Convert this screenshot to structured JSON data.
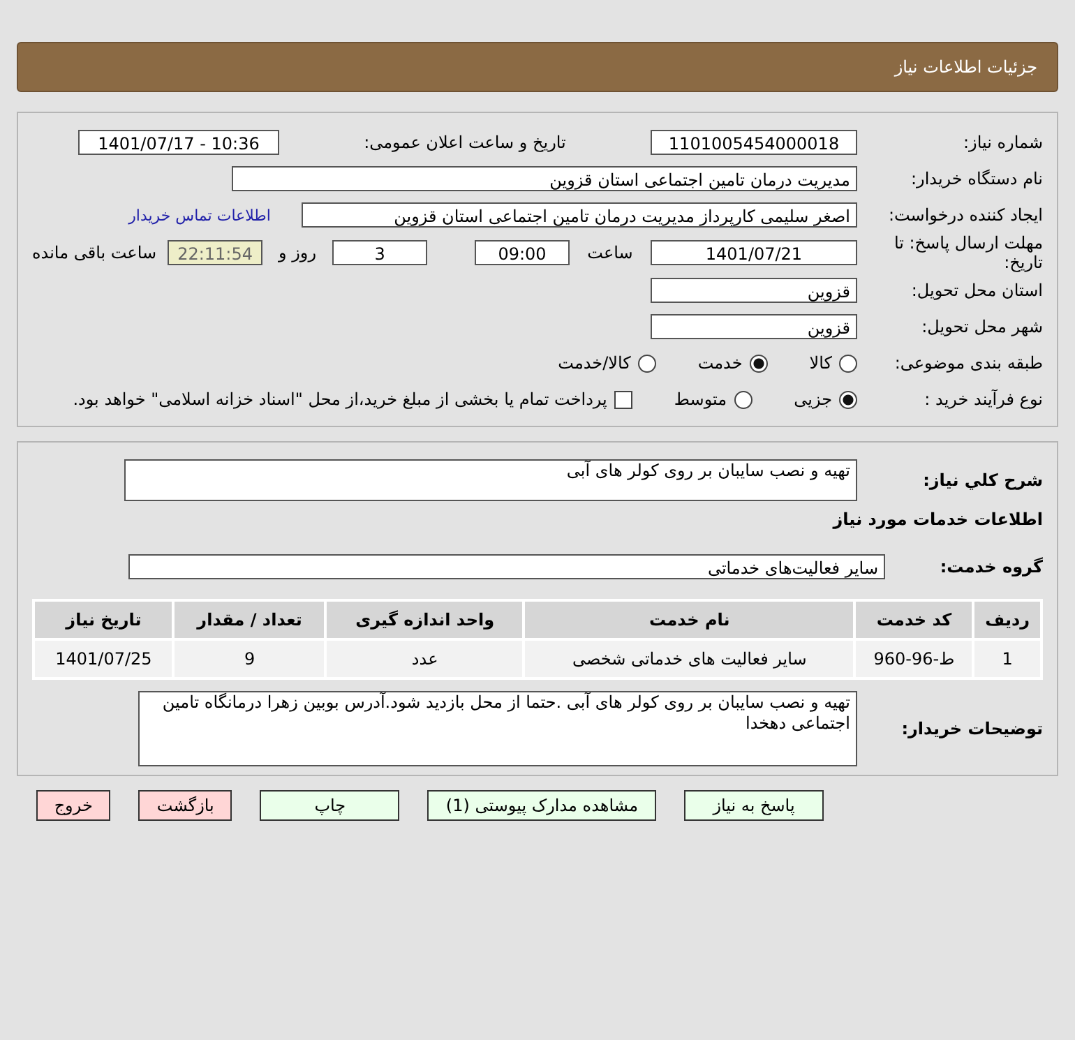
{
  "header": {
    "title": "جزئیات اطلاعات نیاز"
  },
  "details": {
    "need_number": {
      "label": "شماره نیاز:",
      "value": "1101005454000018"
    },
    "announce": {
      "label": "تاریخ و ساعت اعلان عمومی:",
      "value": "1401/07/17 - 10:36"
    },
    "buyer": {
      "label": "نام دستگاه خریدار:",
      "value": "مدیریت درمان تامین اجتماعی استان قزوین"
    },
    "creator": {
      "label": "ایجاد کننده درخواست:",
      "value": "اصغر سلیمی کارپرداز مدیریت درمان تامین اجتماعی استان قزوین",
      "link": "اطلاعات تماس خریدار"
    },
    "deadline": {
      "label": "مهلت ارسال پاسخ: تا تاریخ:",
      "date": "1401/07/21",
      "time_label": "ساعت",
      "time": "09:00",
      "days": "3",
      "days_label": "روز و",
      "remaining": "22:11:54",
      "remaining_label": "ساعت باقی مانده"
    },
    "province": {
      "label": "استان محل تحویل:",
      "value": "قزوین"
    },
    "city": {
      "label": "شهر محل تحویل:",
      "value": "قزوین"
    },
    "category": {
      "label": "طبقه بندی موضوعی:",
      "options": [
        {
          "label": "کالا",
          "selected": false
        },
        {
          "label": "خدمت",
          "selected": true
        },
        {
          "label": "کالا/خدمت",
          "selected": false
        }
      ]
    },
    "purchase_type": {
      "label": "نوع فرآیند خرید :",
      "options": [
        {
          "label": "جزیی",
          "selected": true
        },
        {
          "label": "متوسط",
          "selected": false
        }
      ],
      "payment_note": {
        "label": "پرداخت تمام یا بخشی از مبلغ خرید،از محل \"اسناد خزانه اسلامی\" خواهد بود.",
        "checked": false
      }
    }
  },
  "summary": {
    "label": "شرح کلي نياز:",
    "value": "تهیه و نصب سایبان بر روی کولر های آبی"
  },
  "services": {
    "title": "اطلاعات خدمات مورد نیاز",
    "group_label": "گروه خدمت:",
    "group_value": "سایر فعالیت‌های خدماتی",
    "table": {
      "columns": [
        "ردیف",
        "کد خدمت",
        "نام خدمت",
        "واحد اندازه گیری",
        "تعداد / مقدار",
        "تاریخ نیاز"
      ],
      "rows": [
        [
          "1",
          "ط-96-960",
          "سایر فعالیت های خدماتی شخصی",
          "عدد",
          "9",
          "1401/07/25"
        ]
      ]
    }
  },
  "buyer_notes": {
    "label": "توضیحات خریدار:",
    "value": "تهیه و نصب سایبان بر روی کولر های آبی .حتما از محل بازدید شود.آدرس بوبین زهرا درمانگاه تامین اجتماعی دهخدا"
  },
  "buttons": [
    {
      "label": "پاسخ به نیاز",
      "kind": "primary"
    },
    {
      "label": "مشاهده مدارک پیوستی (1)",
      "kind": "primary"
    },
    {
      "label": "چاپ",
      "kind": "primary"
    },
    {
      "label": "بازگشت",
      "kind": "danger"
    },
    {
      "label": "خروج",
      "kind": "danger"
    }
  ]
}
